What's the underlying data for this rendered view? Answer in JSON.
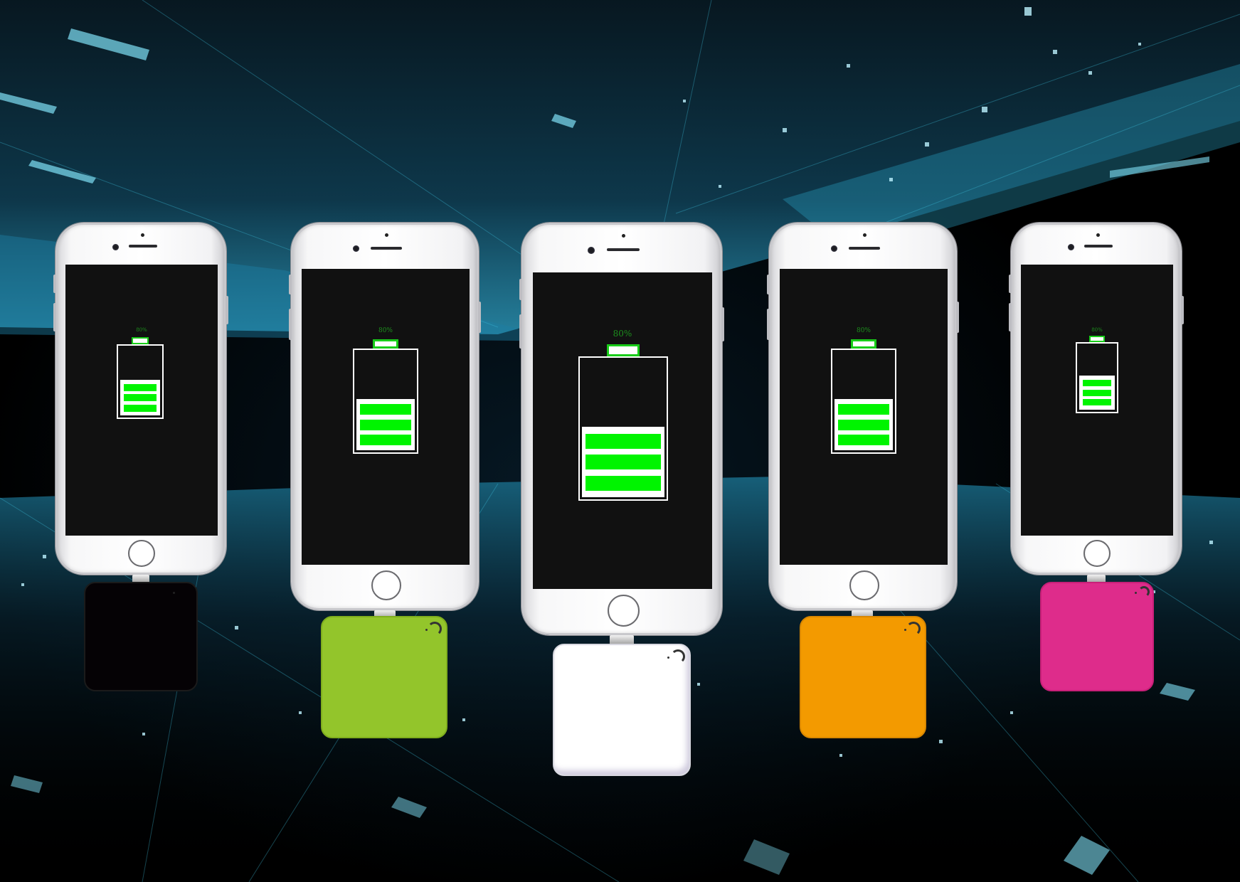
{
  "scene": {
    "background": "dark digital cyberspace grid with cyan light streaks",
    "accent_color": "#00f400",
    "devices": [
      {
        "id": "phone-1",
        "battery_label": "80%",
        "battery_level": 0.8,
        "bar_count": 3,
        "powerbank_color": "#050205",
        "powerbank_name": "black-powerbank"
      },
      {
        "id": "phone-2",
        "battery_label": "80%",
        "battery_level": 0.8,
        "bar_count": 3,
        "powerbank_color": "#93c52b",
        "powerbank_name": "green-powerbank"
      },
      {
        "id": "phone-3",
        "battery_label": "80%",
        "battery_level": 0.8,
        "bar_count": 3,
        "powerbank_color": "#ffffff",
        "powerbank_name": "white-powerbank"
      },
      {
        "id": "phone-4",
        "battery_label": "80%",
        "battery_level": 0.8,
        "bar_count": 3,
        "powerbank_color": "#f39a00",
        "powerbank_name": "orange-powerbank"
      },
      {
        "id": "phone-5",
        "battery_label": "80%",
        "battery_level": 0.8,
        "bar_count": 3,
        "powerbank_color": "#de2c8b",
        "powerbank_name": "pink-powerbank"
      }
    ]
  }
}
